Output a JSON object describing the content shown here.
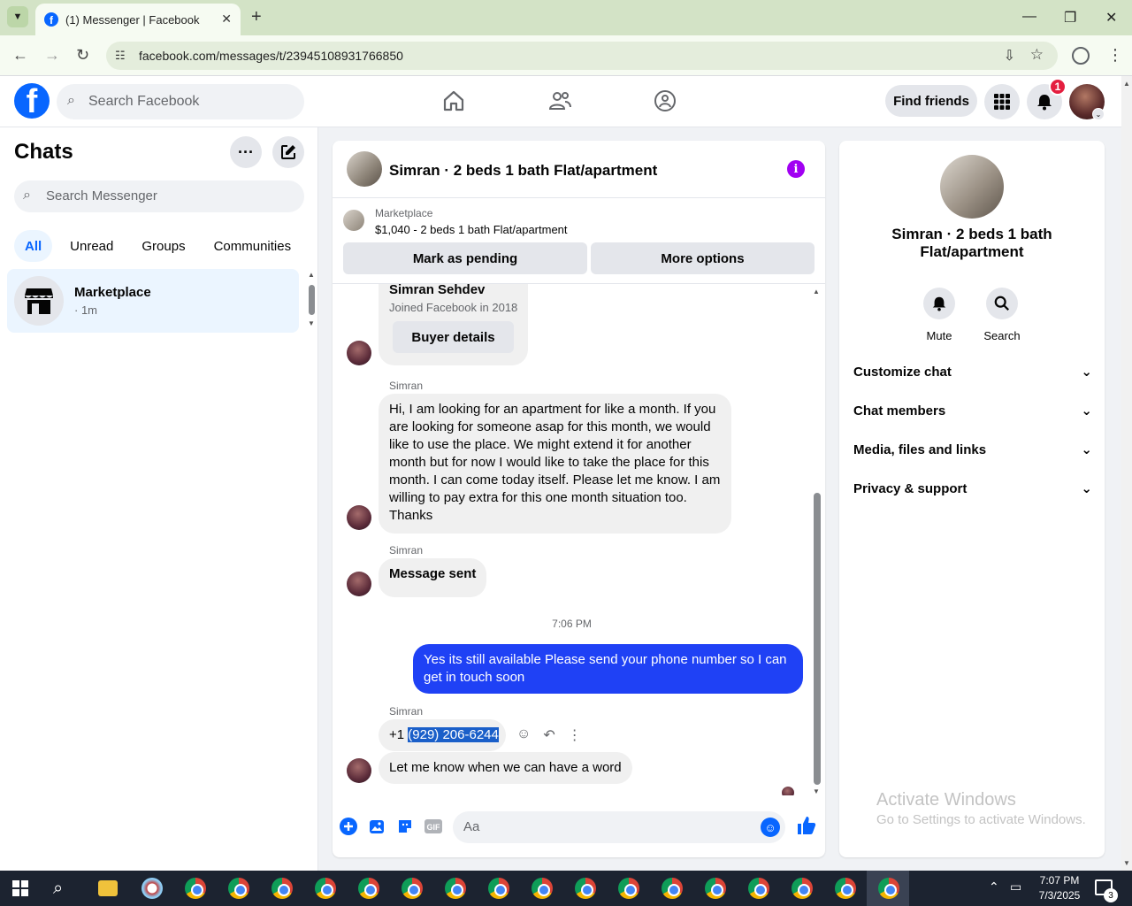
{
  "browser": {
    "tab_title": "(1) Messenger | Facebook",
    "url": "facebook.com/messages/t/23945108931766850"
  },
  "fb_header": {
    "search_placeholder": "Search Facebook",
    "find_friends": "Find friends",
    "notification_count": "1"
  },
  "sidebar": {
    "title": "Chats",
    "search_placeholder": "Search Messenger",
    "filters": [
      "All",
      "Unread",
      "Groups",
      "Communities"
    ],
    "active_filter": "All",
    "chats": [
      {
        "name": "Marketplace",
        "time": "· 1m"
      }
    ]
  },
  "conversation": {
    "title": "Simran · 2 beds 1 bath Flat/apartment",
    "marketplace_label": "Marketplace",
    "listing": "$1,040 - 2 beds 1 bath Flat/apartment",
    "mark_pending": "Mark as pending",
    "more_options": "More options",
    "buyer_card": {
      "name": "Simran Sehdev",
      "joined": "Joined Facebook in 2018",
      "button": "Buyer details"
    },
    "messages": [
      {
        "sender": "Simran",
        "text": "Hi, I am looking for an apartment for like a month. If you are looking for someone asap for this month, we would like to use the place. We might extend it for another month but for now I would like to take the place for this month. I can come today itself. Please let me know. I am willing to pay extra for this one month situation too. Thanks"
      },
      {
        "sender": "Simran",
        "text": "Message sent"
      },
      {
        "timestamp": "7:06 PM"
      },
      {
        "sender": "me",
        "text": "Yes its still available Please send your phone number so I can get in touch soon"
      },
      {
        "sender": "Simran",
        "phone_prefix": "+1 ",
        "phone_selected": "(929) 206-6244"
      },
      {
        "sender": "",
        "text": "Let me know when we can have a word"
      }
    ],
    "composer_placeholder": "Aa"
  },
  "info_panel": {
    "title": "Simran · 2 beds 1 bath Flat/apartment",
    "mute": "Mute",
    "search": "Search",
    "sections": [
      "Customize chat",
      "Chat members",
      "Media, files and links",
      "Privacy & support"
    ],
    "watermark_title": "Activate Windows",
    "watermark_sub": "Go to Settings to activate Windows."
  },
  "taskbar": {
    "time": "7:07 PM",
    "date": "7/3/2025",
    "notif_count": "3"
  },
  "colors": {
    "fb_blue": "#0866ff",
    "outgoing_bubble": "#1f41f5",
    "info_purple": "#a100f2",
    "badge_red": "#e41e3f"
  }
}
